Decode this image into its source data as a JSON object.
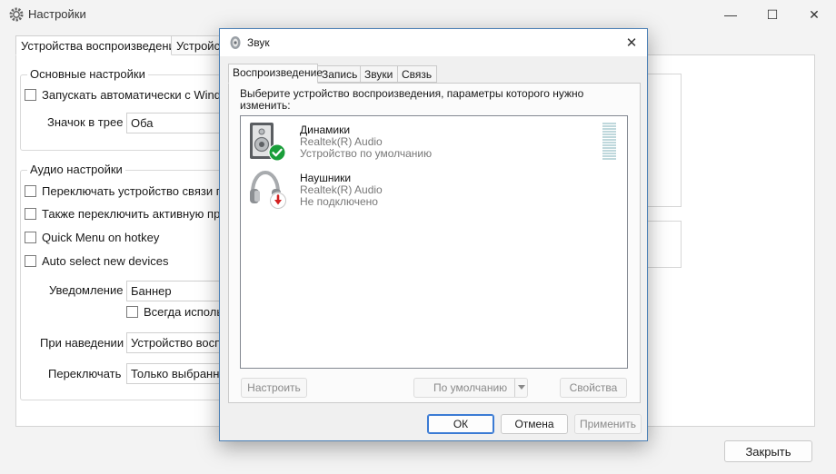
{
  "main_window": {
    "title": "Настройки",
    "controls": {
      "minimize": "—",
      "maximize": "☐",
      "close": "✕"
    },
    "tabs": [
      "Устройства воспроизведения",
      "Устройст"
    ],
    "basic_group": {
      "label": "Основные настройки",
      "autostart": "Запускать автоматически с Windows",
      "tray_icon_label": "Значок в трее",
      "tray_icon_value": "Оба"
    },
    "audio_group": {
      "label": "Аудио настройки",
      "switch_comm": "Переключать устройство связи по умолчанию",
      "switch_active": "Также переключить активную программу",
      "quick_menu": "Quick Menu on hotkey",
      "auto_select": "Auto select new devices",
      "notify_label": "Уведомление",
      "notify_value": "Баннер",
      "always_use": "Всегда использовать",
      "hover_label": "При наведении",
      "hover_value": "Устройство воспроизведения",
      "switch_label": "Переключать",
      "switch_value": "Только выбранные"
    },
    "close_button": "Закрыть"
  },
  "sound_dialog": {
    "title": "Звук",
    "close": "✕",
    "tabs": [
      "Воспроизведение",
      "Запись",
      "Звуки",
      "Связь"
    ],
    "instruction": "Выберите устройство воспроизведения, параметры которого нужно изменить:",
    "devices": [
      {
        "name": "Динамики",
        "driver": "Realtek(R) Audio",
        "status": "Устройство по умолчанию",
        "icon": "speaker-icon",
        "badge": "check-badge-icon",
        "badge_color": "#1a9e3a"
      },
      {
        "name": "Наушники",
        "driver": "Realtek(R) Audio",
        "status": "Не подключено",
        "icon": "headphones-icon",
        "badge": "down-arrow-badge-icon",
        "badge_color": "#d32020"
      }
    ],
    "buttons": {
      "configure": "Настроить",
      "set_default": "По умолчанию",
      "properties": "Свойства",
      "ok": "ОК",
      "cancel": "Отмена",
      "apply": "Применить"
    }
  },
  "colors": {
    "accent_border": "#4a7fb5",
    "level_meter": "#bfd8dc"
  }
}
